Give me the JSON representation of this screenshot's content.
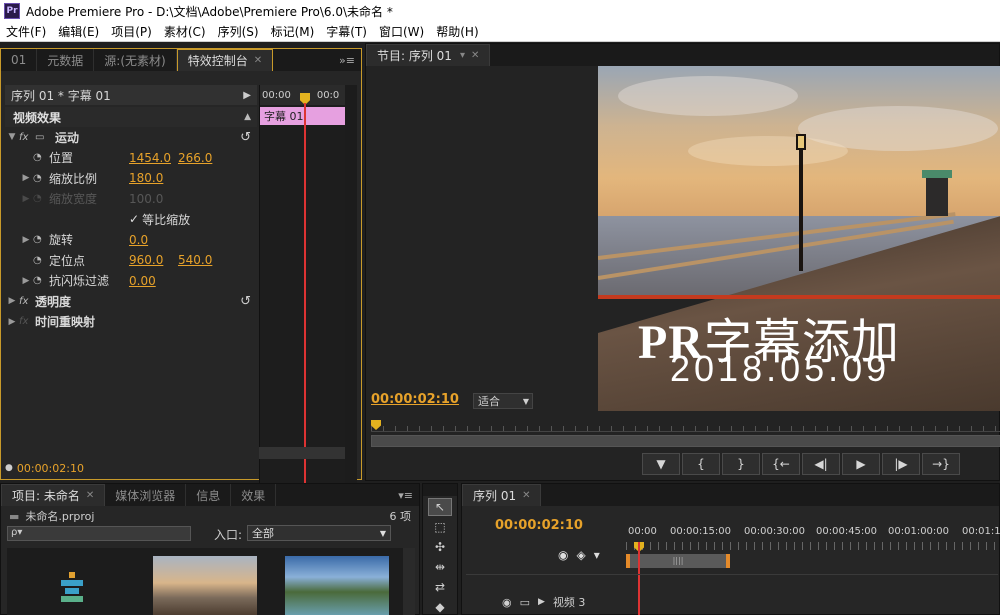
{
  "window": {
    "title": "Adobe Premiere Pro - D:\\文档\\Adobe\\Premiere Pro\\6.0\\未命名 *",
    "logo": "Pr"
  },
  "menu": [
    "文件(F)",
    "编辑(E)",
    "项目(P)",
    "素材(C)",
    "序列(S)",
    "标记(M)",
    "字幕(T)",
    "窗口(W)",
    "帮助(H)"
  ],
  "effects_panel": {
    "tabs": [
      {
        "label": "01"
      },
      {
        "label": "元数据"
      },
      {
        "label": "源:(无素材)"
      },
      {
        "label": "特效控制台",
        "active": true
      }
    ],
    "header": "序列 01 * 字幕 01",
    "section": "视频效果",
    "timeline_start": "00:00",
    "timeline_mid": "00:0",
    "clip_label": "字幕 01",
    "rows": [
      {
        "label": "运动",
        "bold": true,
        "fx": "fx",
        "reset": "↺"
      },
      {
        "label": "位置",
        "v1": "1454.0",
        "v2": "266.0"
      },
      {
        "label": "缩放比例",
        "v1": "180.0"
      },
      {
        "label": "缩放宽度",
        "v1": "100.0",
        "dim": true
      },
      {
        "label": "等比缩放",
        "checkbox": true,
        "checked": true
      },
      {
        "label": "旋转",
        "v1": "0.0"
      },
      {
        "label": "定位点",
        "v1": "960.0",
        "v2": "540.0"
      },
      {
        "label": "抗闪烁过滤",
        "v1": "0.00"
      },
      {
        "label": "透明度",
        "bold": true,
        "fx": "fx",
        "reset": "↺"
      },
      {
        "label": "时间重映射",
        "bold": true,
        "fx": "fx"
      }
    ],
    "footer_timecode": "00:00:02:10"
  },
  "program_monitor": {
    "tab": "节目: 序列 01",
    "overlay_title_a": "PR",
    "overlay_title_b": "字幕添加",
    "overlay_date": "2018.05.09",
    "timecode": "00:00:02:10",
    "fit": "适合",
    "transport": [
      "▼",
      "{",
      "}",
      "{←",
      "◀|",
      "▶",
      "|▶",
      "→}"
    ]
  },
  "project_panel": {
    "tabs": [
      {
        "label": "项目: 未命名",
        "active": true
      },
      {
        "label": "媒体浏览器"
      },
      {
        "label": "信息"
      },
      {
        "label": "效果"
      }
    ],
    "file": "未命名.prproj",
    "count": "6 项",
    "search_placeholder": "ρ▾",
    "in_label": "入口:",
    "in_value": "全部"
  },
  "timeline": {
    "tab": "序列 01",
    "timecode": "00:00:02:10",
    "ruler": [
      "00:00",
      "00:00:15:00",
      "00:00:30:00",
      "00:00:45:00",
      "00:01:00:00",
      "00:01:1"
    ],
    "track_label": "视频 3"
  },
  "colors": {
    "accent": "#e7a22a",
    "playhead": "#e3b21f",
    "clip": "#e6a0e0",
    "playline": "#dd3333"
  }
}
